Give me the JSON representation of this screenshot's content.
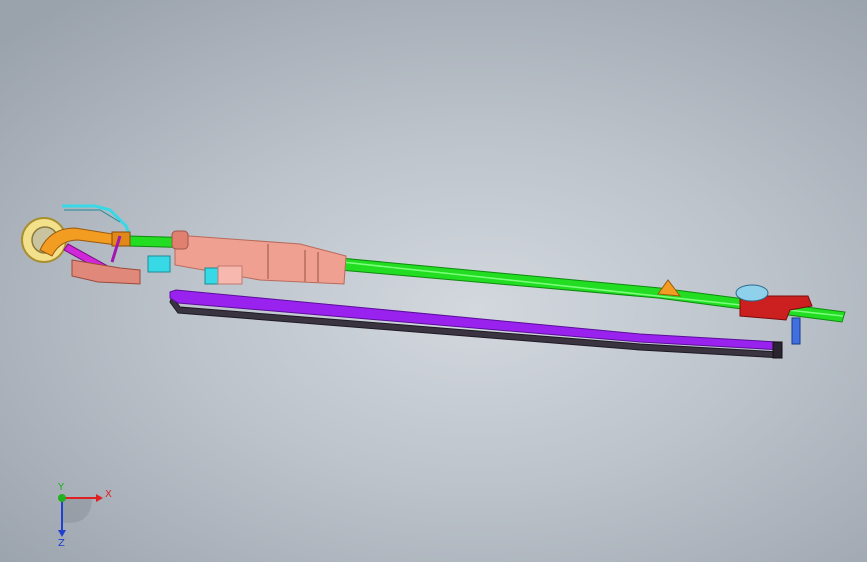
{
  "viewport": {
    "background_top": "#9aa2ac",
    "background_center": "#d3d8de"
  },
  "model": {
    "parts": [
      {
        "name": "green-rod",
        "color": "#22dd22"
      },
      {
        "name": "purple-base-plate",
        "color": "#9a22ee"
      },
      {
        "name": "pink-block",
        "color": "#f0a090"
      },
      {
        "name": "red-clamp",
        "color": "#cc1f1f"
      },
      {
        "name": "yellow-wheel",
        "color": "#f2e08a"
      },
      {
        "name": "orange-tube",
        "color": "#f39c22"
      },
      {
        "name": "cyan-wire",
        "color": "#38d9e6"
      },
      {
        "name": "blue-dome",
        "color": "#8fd0ea"
      }
    ]
  },
  "triad": {
    "x_label": "X",
    "y_label": "Y",
    "z_label": "Z",
    "x_color": "#e02020",
    "y_color": "#20b020",
    "z_color": "#2040d0"
  }
}
